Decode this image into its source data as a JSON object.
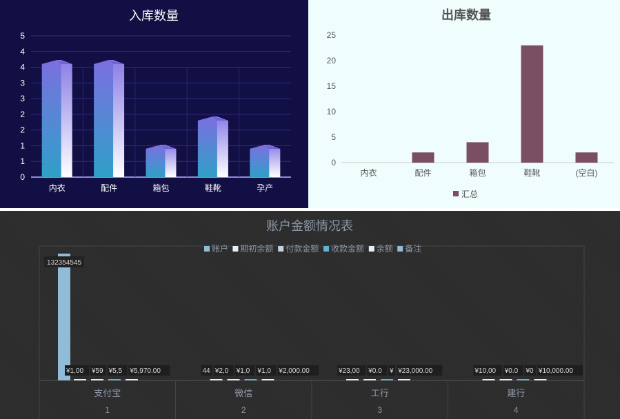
{
  "chart_data": [
    {
      "type": "bar",
      "title": "入库数量",
      "categories": [
        "内衣",
        "配件",
        "箱包",
        "鞋靴",
        "孕产"
      ],
      "values": [
        4,
        4,
        1,
        2,
        1
      ],
      "ylim": [
        0,
        5
      ],
      "y_ticks": [
        "0",
        "1",
        "1",
        "2",
        "2",
        "3",
        "3",
        "4",
        "4",
        "5"
      ],
      "grid": true,
      "colors": {
        "top": "#7c6fe0",
        "bottom": "#2fa0c8",
        "side": "#ffffff"
      }
    },
    {
      "type": "bar",
      "title": "出库数量",
      "categories": [
        "内衣",
        "配件",
        "箱包",
        "鞋靴",
        "(空白)"
      ],
      "series": [
        {
          "name": "汇总",
          "values": [
            0,
            2,
            4,
            23,
            2
          ]
        }
      ],
      "ylim": [
        0,
        25
      ],
      "y_ticks": [
        "0",
        "5",
        "10",
        "15",
        "20",
        "25"
      ],
      "legend": "bottom",
      "colors": {
        "bar": "#7a4e63"
      }
    },
    {
      "type": "bar",
      "title": "账户金额情况表",
      "legend": "top",
      "legend_items": [
        "账户",
        "期初余额",
        "付款金额",
        "收款金额",
        "余额",
        "备注"
      ],
      "categories": [
        "支付宝",
        "微信",
        "工行",
        "建行"
      ],
      "category_index": [
        "1",
        "2",
        "3",
        "4"
      ],
      "bar_value_label": "132354545",
      "series": [
        {
          "name": "账户",
          "values": [
            132354545,
            0,
            0,
            0
          ]
        },
        {
          "name": "期初余额",
          "values": [
            1000,
            0,
            23000,
            10000
          ]
        },
        {
          "name": "付款金额",
          "values": [
            0,
            2000,
            0,
            0
          ]
        },
        {
          "name": "收款金额",
          "values": [
            5500,
            1000,
            0,
            0
          ]
        },
        {
          "name": "余额",
          "values": [
            5970,
            2000,
            23000,
            10000
          ]
        }
      ],
      "data_labels": [
        [
          "¥1,00",
          "¥59",
          "¥5,5",
          "¥5,970.00"
        ],
        [
          "44",
          "¥2,0",
          "¥1,0",
          "¥1,0",
          "¥2,000.00"
        ],
        [
          "¥23,00",
          "¥0.0",
          "¥",
          "¥23,000.00"
        ],
        [
          "¥10,00",
          "¥0.0",
          "¥0",
          "¥10,000.00"
        ]
      ],
      "colors": {
        "accent": "#90bcd8",
        "light": "#e8eef4",
        "teal": "#5fb4d2"
      }
    }
  ]
}
